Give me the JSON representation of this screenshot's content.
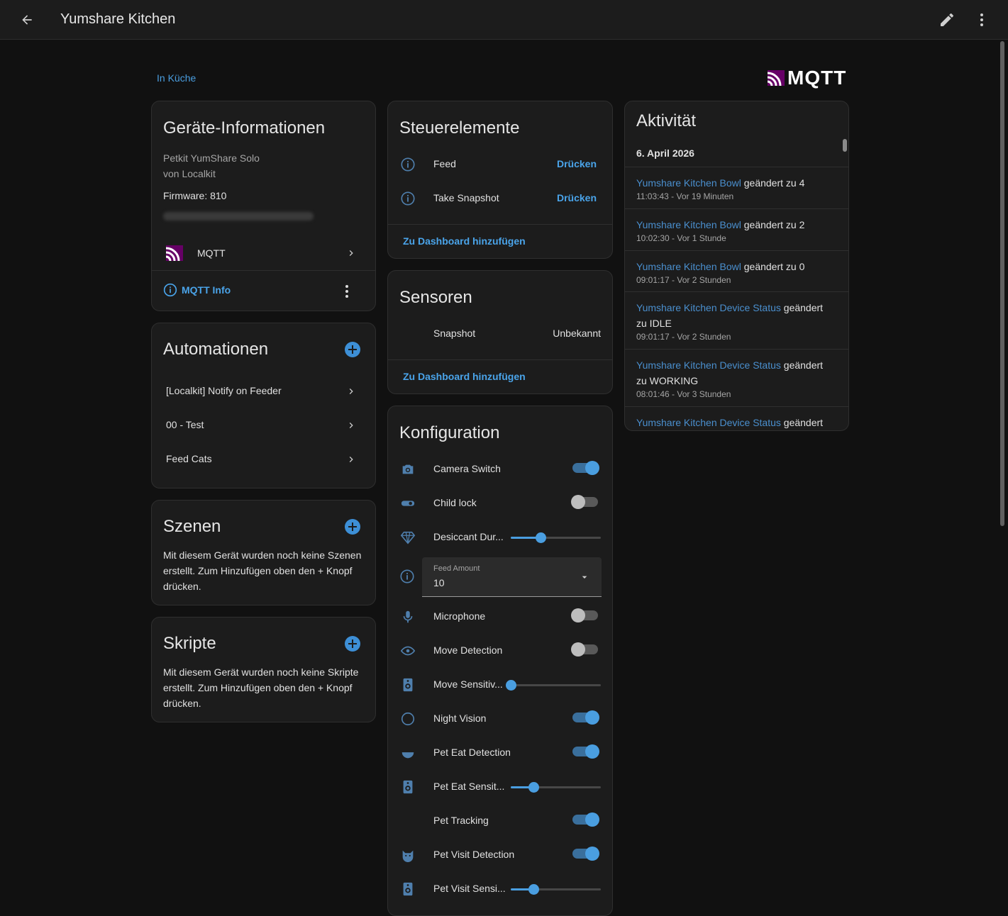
{
  "header": {
    "title": "Yumshare Kitchen"
  },
  "breadcrumb": "In Küche",
  "logo": {
    "text": "MQTT",
    "color": "#660066"
  },
  "device_info": {
    "title": "Geräte-Informationen",
    "model": "Petkit YumShare Solo",
    "manufacturer": "von Localkit",
    "firmware": "Firmware: 810",
    "integration": "MQTT",
    "info_link": "MQTT Info"
  },
  "automations": {
    "title": "Automationen",
    "items": [
      "[Localkit] Notify on Feeder",
      "00 - Test",
      "Feed Cats"
    ]
  },
  "scenes": {
    "title": "Szenen",
    "empty_text": "Mit diesem Gerät wurden noch keine Szenen erstellt. Zum Hinzufügen oben den + Knopf drücken."
  },
  "scripts": {
    "title": "Skripte",
    "empty_text": "Mit diesem Gerät wurden noch keine Skripte erstellt. Zum Hinzufügen oben den + Knopf drücken."
  },
  "controls": {
    "title": "Steuerelemente",
    "items": [
      {
        "name": "Feed",
        "action": "Drücken"
      },
      {
        "name": "Take Snapshot",
        "action": "Drücken"
      }
    ],
    "add_link": "Zu Dashboard hinzufügen"
  },
  "sensors": {
    "title": "Sensoren",
    "items": [
      {
        "name": "Snapshot",
        "value": "Unbekannt"
      }
    ],
    "add_link": "Zu Dashboard hinzufügen"
  },
  "config": {
    "title": "Konfiguration",
    "camera_switch": {
      "name": "Camera Switch",
      "on": true
    },
    "child_lock": {
      "name": "Child lock",
      "on": false
    },
    "desiccant": {
      "name": "Desiccant Dur...",
      "fraction": 0.33
    },
    "feed_amount": {
      "label": "Feed Amount",
      "value": "10"
    },
    "microphone": {
      "name": "Microphone",
      "on": false
    },
    "move_detection": {
      "name": "Move Detection",
      "on": false
    },
    "move_sensitivity": {
      "name": "Move Sensitiv...",
      "fraction": 0.0
    },
    "night_vision": {
      "name": "Night Vision",
      "on": true
    },
    "pet_eat_detection": {
      "name": "Pet Eat Detection",
      "on": true
    },
    "pet_eat_sensitivity": {
      "name": "Pet Eat Sensit...",
      "fraction": 0.25
    },
    "pet_tracking": {
      "name": "Pet Tracking",
      "on": true
    },
    "pet_visit_detection": {
      "name": "Pet Visit Detection",
      "on": true
    },
    "pet_visit_sensitivity": {
      "name": "Pet Visit Sensi...",
      "fraction": 0.25
    }
  },
  "activity": {
    "title": "Aktivität",
    "date": "6. April 2026",
    "entries": [
      {
        "entity": "Yumshare Kitchen Bowl",
        "change": " geändert zu 4",
        "time": "11:03:43 - Vor 19 Minuten"
      },
      {
        "entity": "Yumshare Kitchen Bowl",
        "change": " geändert zu 2",
        "time": "10:02:30 - Vor 1 Stunde"
      },
      {
        "entity": "Yumshare Kitchen Bowl",
        "change": " geändert zu 0",
        "time": "09:01:17 - Vor 2 Stunden"
      },
      {
        "entity": "Yumshare Kitchen Device Status",
        "change": " geändert zu IDLE",
        "time": "09:01:17 - Vor 2 Stunden"
      },
      {
        "entity": "Yumshare Kitchen Device Status",
        "change": " geändert zu WORKING",
        "time": "08:01:46 - Vor 3 Stunden"
      },
      {
        "entity": "Yumshare Kitchen Device Status",
        "change": " geändert",
        "time": ""
      }
    ]
  }
}
